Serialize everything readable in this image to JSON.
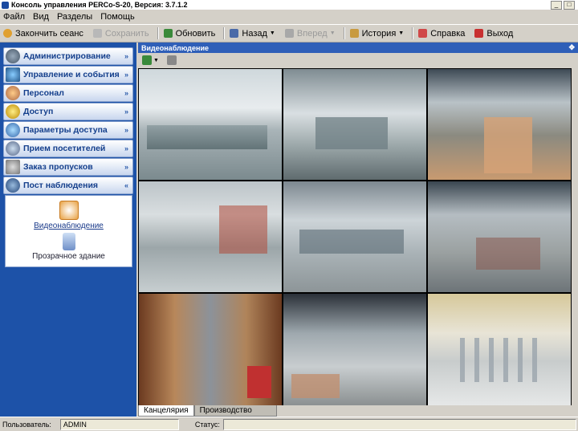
{
  "window": {
    "title": "Консоль управления PERCo-S-20, Версия: 3.7.1.2"
  },
  "menu": [
    "Файл",
    "Вид",
    "Разделы",
    "Помощь"
  ],
  "toolbar": {
    "end_session": "Закончить сеанс",
    "save": "Сохранить",
    "refresh": "Обновить",
    "back": "Назад",
    "forward": "Вперед",
    "history": "История",
    "help": "Справка",
    "exit": "Выход"
  },
  "sidebar": {
    "items": [
      {
        "label": "Администрирование",
        "icon": "gears-icon"
      },
      {
        "label": "Управление и события",
        "icon": "monitor-icon"
      },
      {
        "label": "Персонал",
        "icon": "people-icon"
      },
      {
        "label": "Доступ",
        "icon": "key-icon"
      },
      {
        "label": "Параметры доступа",
        "icon": "globe-icon"
      },
      {
        "label": "Прием посетителей",
        "icon": "visitor-icon"
      },
      {
        "label": "Заказ пропусков",
        "icon": "pass-icon"
      },
      {
        "label": "Пост наблюдения",
        "icon": "guard-icon"
      }
    ],
    "panel_links": [
      {
        "label": "Видеонаблюдение",
        "icon": "video-icon"
      },
      {
        "label": "Прозрачное здание",
        "icon": "building-icon"
      }
    ]
  },
  "main": {
    "header": "Видеонаблюдение",
    "tabs": [
      "Канцелярия",
      "Производство"
    ]
  },
  "status": {
    "user_label": "Пользователь:",
    "user_value": "ADMIN",
    "status_label": "Статус:"
  },
  "colors": {
    "sidebar": "#1d52a8",
    "header": "#2f5fb8"
  }
}
